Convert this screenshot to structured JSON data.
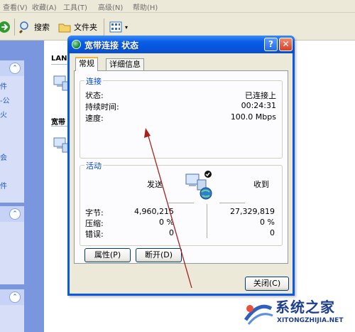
{
  "menubar": {
    "items": [
      "查看(V)",
      "收藏(A)",
      "工具(T)",
      "高级(N)",
      "帮助(H)"
    ]
  },
  "toolbar": {
    "search_label": "搜索",
    "folders_label": "文件夹"
  },
  "filepane": {
    "groups": [
      "LAN",
      "宽带"
    ]
  },
  "leftpane": {
    "task_fragments": [
      "件",
      "-公",
      "火",
      "会",
      "件"
    ]
  },
  "dialog": {
    "title": "宽带连接 状态",
    "help_glyph": "?",
    "close_glyph": "✕",
    "tabs": [
      {
        "label": "常规",
        "active": true
      },
      {
        "label": "详细信息",
        "active": false
      }
    ],
    "connection": {
      "group_title": "连接",
      "status_label": "状态:",
      "status_value": "已连接上",
      "duration_label": "持续时间:",
      "duration_value": "00:24:31",
      "speed_label": "速度:",
      "speed_value": "100.0 Mbps"
    },
    "activity": {
      "group_title": "活动",
      "sent_label": "发送",
      "received_label": "收到",
      "bytes_label": "字节:",
      "bytes_sent": "4,960,215",
      "bytes_received": "27,329,819",
      "compression_label": "压缩:",
      "compression_sent": "0 %",
      "compression_received": "0 %",
      "errors_label": "错误:",
      "errors_sent": "0",
      "errors_received": "0"
    },
    "buttons": {
      "properties": "属性(P)",
      "disconnect": "断开(D)",
      "close": "关闭(C)"
    }
  },
  "watermark": {
    "title": "系统之家",
    "url": "XITONGZHIJIA.NET"
  },
  "colors": {
    "titlebar": "#0a5ee8",
    "group_title": "#0046d5",
    "arrow": "#a8201e",
    "tab_highlight": "#f1b53c"
  }
}
